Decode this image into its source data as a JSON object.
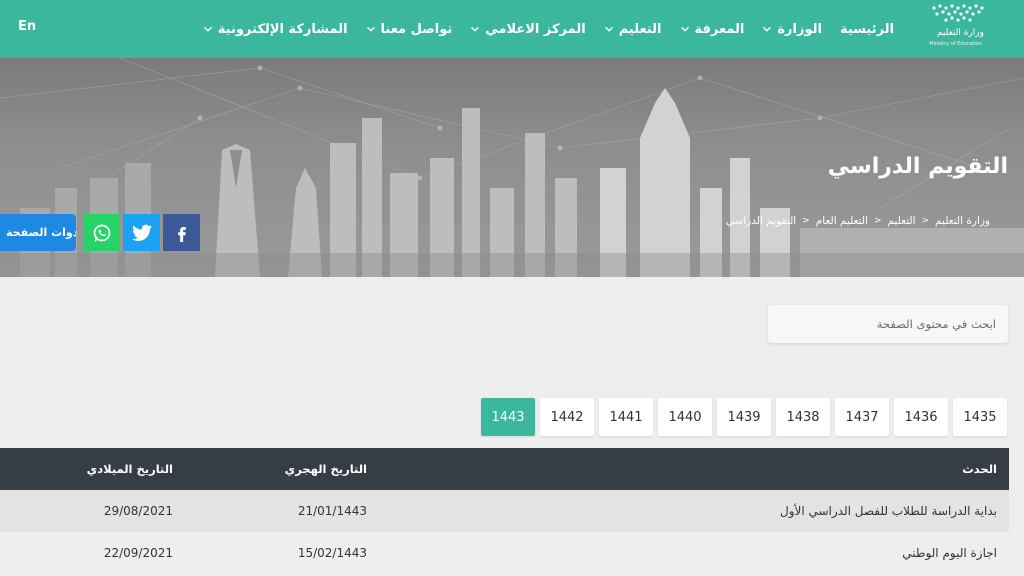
{
  "header": {
    "logo_text": "وزارة التعليم",
    "logo_subtext": "Ministry of Education",
    "lang_toggle": "En",
    "nav": [
      {
        "label": "الرئيسية",
        "dropdown": false
      },
      {
        "label": "الوزارة",
        "dropdown": true
      },
      {
        "label": "المعرفة",
        "dropdown": true
      },
      {
        "label": "التعليم",
        "dropdown": true
      },
      {
        "label": "المركز الاعلامي",
        "dropdown": true
      },
      {
        "label": "تواصل معنا",
        "dropdown": true
      },
      {
        "label": "المشاركة الإلكترونية",
        "dropdown": true
      }
    ]
  },
  "hero": {
    "title": "التقويم الدراسي",
    "breadcrumb": [
      "وزارة التعليم",
      "التعليم",
      "التعليم العام",
      "التقويم الدراسي"
    ],
    "tools_label": "ادوات الصفحة"
  },
  "search": {
    "placeholder": "ابحث في محتوى الصفحة"
  },
  "years": [
    "1435",
    "1436",
    "1437",
    "1438",
    "1439",
    "1440",
    "1441",
    "1442",
    "1443"
  ],
  "active_year": "1443",
  "table": {
    "headers": {
      "event": "الحدث",
      "hijri": "التاريخ الهجري",
      "gregorian": "التاريخ الميلادي"
    },
    "rows": [
      {
        "event": "بداية الدراسة للطلاب للفصل الدراسي الأول",
        "hijri": "21/01/1443",
        "gregorian": "29/08/2021"
      },
      {
        "event": "اجازة اليوم الوطني",
        "hijri": "15/02/1443",
        "gregorian": "22/09/2021"
      }
    ]
  },
  "colors": {
    "brand": "#3bb79d",
    "table_header": "#363d45",
    "facebook": "#3b5998",
    "twitter": "#1da1f2",
    "whatsapp": "#25d366",
    "tools": "#1e88e5"
  }
}
